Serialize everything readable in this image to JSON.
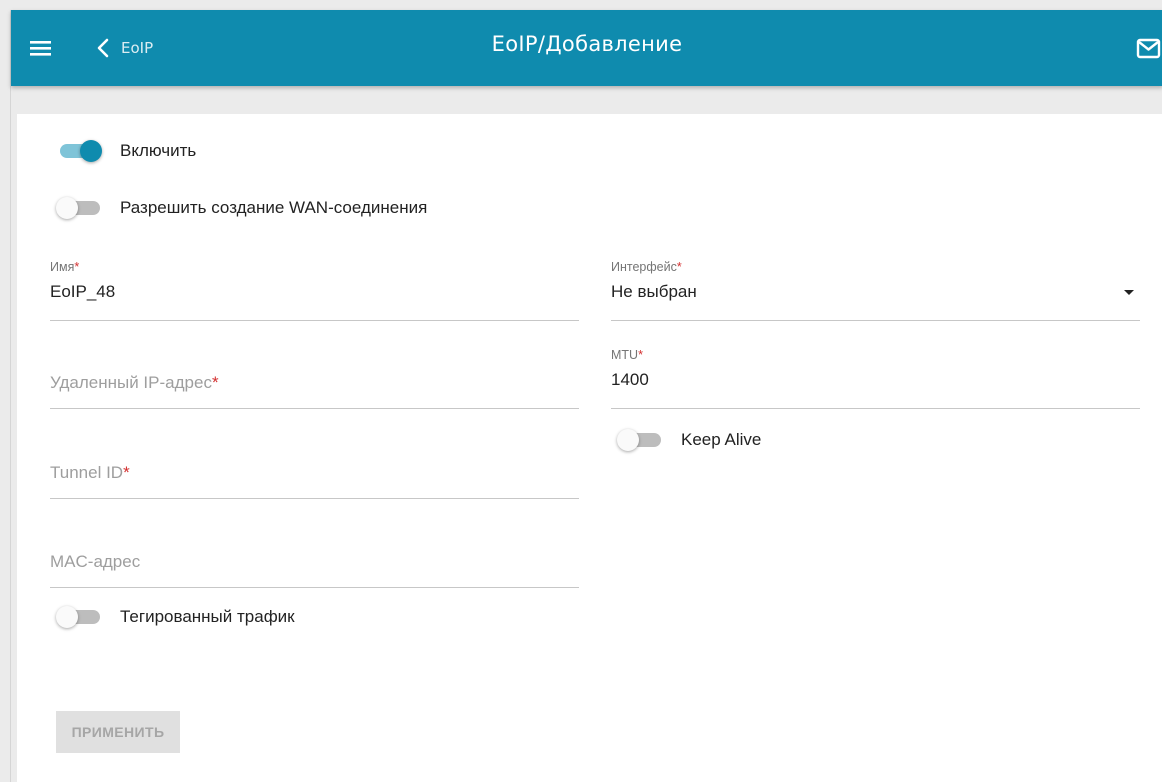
{
  "header": {
    "back_label": "EoIP",
    "title": "EoIP/Добавление",
    "menu_icon": "hamburger-menu-icon",
    "back_icon": "chevron-left-icon",
    "mail_icon": "mail-icon",
    "background_color": "#0f8bae"
  },
  "form": {
    "enable": {
      "label": "Включить",
      "on": true
    },
    "allow_wan": {
      "label": "Разрешить создание WAN-соединения",
      "on": false
    },
    "name": {
      "label": "Имя",
      "required_mark": "*",
      "value": "EoIP_48"
    },
    "interface": {
      "label": "Интерфейс",
      "required_mark": "*",
      "value": "Не выбран"
    },
    "remote_ip": {
      "placeholder": "Удаленный IP-адрес",
      "required_mark": "*",
      "value": ""
    },
    "mtu": {
      "label": "MTU",
      "required_mark": "*",
      "value": "1400"
    },
    "tunnel_id": {
      "placeholder": "Tunnel ID",
      "required_mark": "*",
      "value": ""
    },
    "keep_alive": {
      "label": "Keep Alive",
      "on": false
    },
    "mac": {
      "placeholder": "MAC-адрес",
      "value": ""
    },
    "tagged": {
      "label": "Тегированный трафик",
      "on": false
    },
    "apply_label": "ПРИМЕНИТЬ"
  },
  "colors": {
    "accent": "#0f8bae",
    "accent_light": "#7fc4d8",
    "required": "#d32f2f",
    "disabled_button": "#e0e0e0"
  }
}
